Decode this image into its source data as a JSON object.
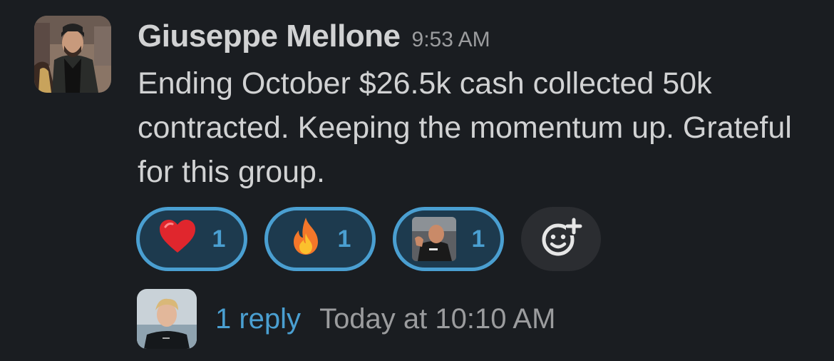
{
  "message": {
    "author": "Giuseppe Mellone",
    "timestamp": "9:53 AM",
    "text": "Ending October $26.5k cash collected 50k contracted. Keeping the momentum up. Grateful for this group."
  },
  "reactions": [
    {
      "emoji": "❤️",
      "icon": "red-heart",
      "count": "1"
    },
    {
      "emoji": "🔥",
      "icon": "fire",
      "count": "1"
    },
    {
      "emoji": "",
      "icon": "custom-photo-emoji",
      "count": "1"
    }
  ],
  "add_reaction": {
    "icon": "add-reaction-smiley-plus"
  },
  "thread": {
    "reply_count": "1 reply",
    "last_reply": "Today at 10:10 AM"
  },
  "colors": {
    "background": "#1a1d21",
    "accent": "#4a9fd1",
    "reaction_bg": "#1d3a4e",
    "muted_text": "#9b9c9e"
  }
}
